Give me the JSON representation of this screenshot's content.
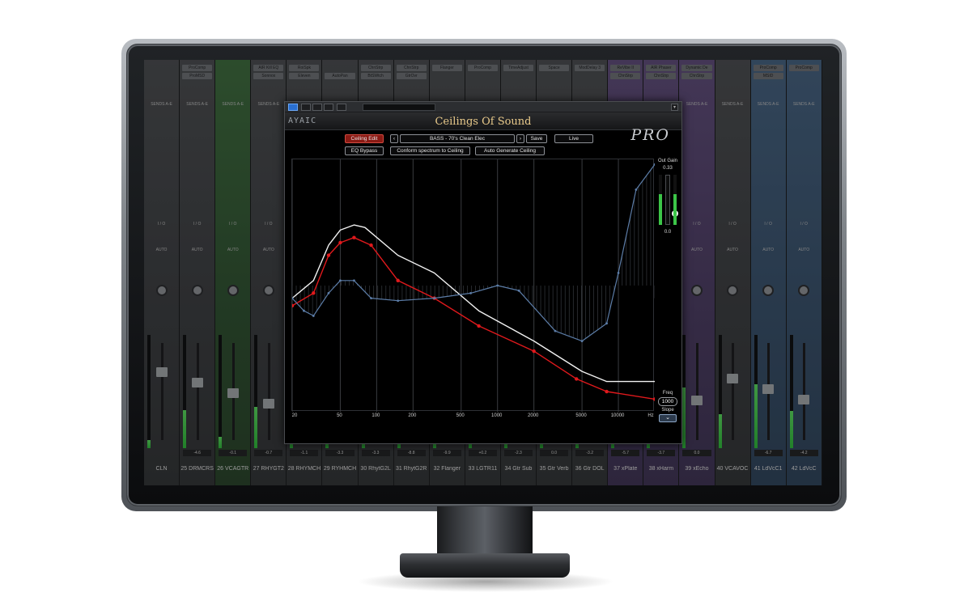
{
  "daw": {
    "channels": [
      {
        "name": "CLN",
        "num": "",
        "color": "grey",
        "vol": "",
        "inserts": [
          "",
          ""
        ]
      },
      {
        "name": "DRMCRS",
        "num": "25",
        "color": "grey",
        "vol": "-4.6",
        "inserts": [
          "ProComp",
          "ProMSD"
        ]
      },
      {
        "name": "VCAGTR",
        "num": "26",
        "color": "green",
        "vol": "-0.1",
        "inserts": [
          "",
          ""
        ]
      },
      {
        "name": "RHYGT2",
        "num": "27",
        "color": "grey",
        "vol": "-0.7",
        "inserts": [
          "AIR Kill EQ",
          "Sonnox"
        ]
      },
      {
        "name": "RHYMCH",
        "num": "28",
        "color": "grey",
        "vol": "-1.1",
        "inserts": [
          "RoiSpk",
          "Eleven"
        ]
      },
      {
        "name": "RYHMCH",
        "num": "29",
        "color": "grey",
        "vol": "-3.3",
        "inserts": [
          "",
          "AutoPan"
        ]
      },
      {
        "name": "RhytG2L",
        "num": "30",
        "color": "grey",
        "vol": "-3.3",
        "inserts": [
          "ChnStrp",
          "BtSWtch"
        ]
      },
      {
        "name": "RhytG2R",
        "num": "31",
        "color": "grey",
        "vol": "-8.8",
        "inserts": [
          "ChnStrp",
          "GtrOvr"
        ]
      },
      {
        "name": "Flanger",
        "num": "32",
        "color": "grey",
        "vol": "-9.9",
        "inserts": [
          "Flanger",
          ""
        ]
      },
      {
        "name": "LGTR11",
        "num": "33",
        "color": "grey",
        "vol": "+0.2",
        "inserts": [
          "ProComp",
          ""
        ]
      },
      {
        "name": "Gtr Sub",
        "num": "34",
        "color": "grey",
        "vol": "-2.3",
        "inserts": [
          "TimeAdjust",
          ""
        ]
      },
      {
        "name": "Gtr Verb",
        "num": "35",
        "color": "grey",
        "vol": "0.0",
        "inserts": [
          "Space",
          ""
        ]
      },
      {
        "name": "Gtr DOL",
        "num": "36",
        "color": "grey",
        "vol": "-3.2",
        "inserts": [
          "ModDelay 3",
          ""
        ]
      },
      {
        "name": "xPlate",
        "num": "37",
        "color": "purple",
        "vol": "-5.7",
        "inserts": [
          "ReVibe II",
          "ChnStrp"
        ]
      },
      {
        "name": "xHarm",
        "num": "38",
        "color": "purple",
        "vol": "-3.7",
        "inserts": [
          "AIR Phaser",
          "ChnStrp"
        ]
      },
      {
        "name": "xEcho",
        "num": "39",
        "color": "purple",
        "vol": "0.0",
        "inserts": [
          "Dynamic De",
          "ChnStrp"
        ]
      },
      {
        "name": "VCAVOC",
        "num": "40",
        "color": "grey",
        "vol": "",
        "inserts": [
          "",
          ""
        ]
      },
      {
        "name": "LdVcC1",
        "num": "41",
        "color": "blue",
        "vol": "-6.7",
        "inserts": [
          "ProComp",
          "MSID"
        ]
      },
      {
        "name": "LdVcC",
        "num": "42",
        "color": "blue",
        "vol": "-4.2",
        "inserts": [
          "ProComp",
          ""
        ]
      }
    ]
  },
  "plugin": {
    "brand": "AYAIC",
    "title": "Ceilings Of Sound",
    "edition": "PRO",
    "buttons": {
      "ceiling_edit": "Ceiling Edit",
      "preset_prev": "‹",
      "preset_name": "BASS - 70's Clean Elec",
      "preset_next": "›",
      "save": "Save",
      "live": "Live",
      "eq_bypass": "EQ Bypass",
      "conform": "Conform spectrum to Ceiling",
      "auto_generate": "Auto Generate Ceiling"
    },
    "out_gain": {
      "label": "Out Gain",
      "value": "0.33",
      "zero": "0.0",
      "level": 0.62
    },
    "freq": {
      "label": "Freq",
      "value": "1000",
      "slope_label": "Slope",
      "slope_icon": "chevron-down-icon"
    },
    "freq_ticks": [
      "20",
      "50",
      "100",
      "200",
      "500",
      "1000",
      "2000",
      "5000",
      "10000",
      "Hz"
    ],
    "colors": {
      "ceiling": "#e0191c",
      "spectrum": "#f2f2f2",
      "eq": "#5c7da8",
      "edit_active": "#8a1a14"
    }
  },
  "chart_data": {
    "type": "line",
    "x_scale": "log",
    "xlim": [
      20,
      20000
    ],
    "ylim": [
      0,
      100
    ],
    "xlabel": "Hz",
    "series": [
      {
        "name": "",
        "role": "ceiling",
        "color": "#e0191c",
        "x": [
          20,
          30,
          40,
          50,
          65,
          90,
          150,
          300,
          700,
          2000,
          4500,
          8000,
          20000
        ],
        "y": [
          42,
          47,
          62,
          67,
          69,
          66,
          52,
          45,
          34,
          24,
          13,
          8,
          5
        ]
      },
      {
        "name": "",
        "role": "spectrum",
        "color": "#f2f2f2",
        "x": [
          20,
          30,
          40,
          50,
          65,
          80,
          150,
          300,
          700,
          2000,
          5000,
          8000,
          20000
        ],
        "y": [
          45,
          52,
          66,
          72,
          74,
          73,
          62,
          55,
          40,
          28,
          16,
          12,
          12
        ]
      },
      {
        "name": "",
        "role": "eq",
        "color": "#5c7da8",
        "x": [
          20,
          25,
          30,
          40,
          50,
          65,
          90,
          150,
          300,
          600,
          1000,
          1500,
          3000,
          5000,
          8000,
          10000,
          14000,
          20000
        ],
        "y": [
          45,
          40,
          38,
          47,
          52,
          52,
          45,
          44,
          45,
          47,
          50,
          48,
          32,
          28,
          35,
          55,
          88,
          98
        ]
      }
    ]
  }
}
